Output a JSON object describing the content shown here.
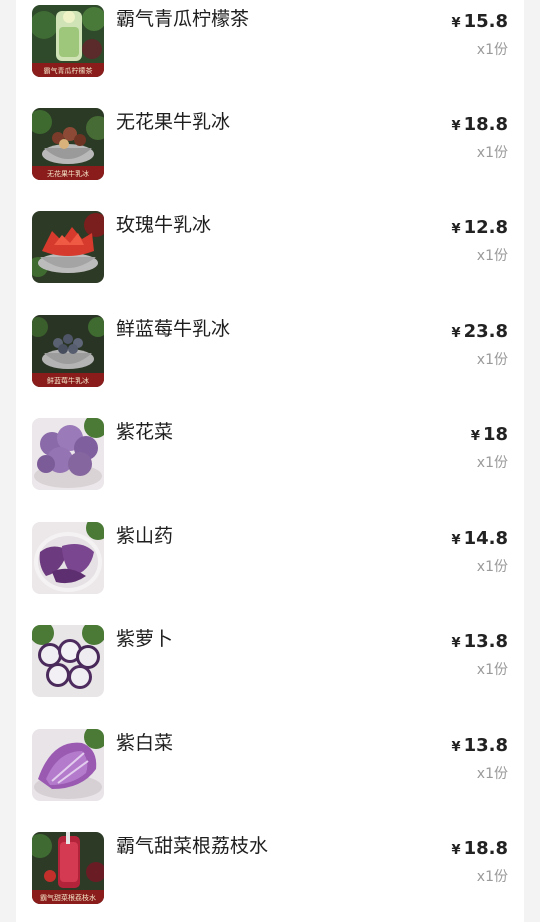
{
  "currency_symbol": "¥",
  "items": [
    {
      "name": "霸气青瓜柠檬茶",
      "price": "15.8",
      "qty": "x1份",
      "image_caption": "霸气青瓜柠檬茶",
      "image": "cucumber-lemon-tea"
    },
    {
      "name": "无花果牛乳冰",
      "price": "18.8",
      "qty": "x1份",
      "image_caption": "无花果牛乳冰",
      "image": "fig-milk-ice"
    },
    {
      "name": "玫瑰牛乳冰",
      "price": "12.8",
      "qty": "x1份",
      "image_caption": "",
      "image": "rose-milk-ice"
    },
    {
      "name": "鲜蓝莓牛乳冰",
      "price": "23.8",
      "qty": "x1份",
      "image_caption": "鲜蓝莓牛乳冰",
      "image": "blueberry-milk-ice"
    },
    {
      "name": "紫花菜",
      "price": "18",
      "qty": "x1份",
      "image_caption": "",
      "image": "purple-cauliflower"
    },
    {
      "name": "紫山药",
      "price": "14.8",
      "qty": "x1份",
      "image_caption": "",
      "image": "purple-yam"
    },
    {
      "name": "紫萝卜",
      "price": "13.8",
      "qty": "x1份",
      "image_caption": "",
      "image": "purple-radish"
    },
    {
      "name": "紫白菜",
      "price": "13.8",
      "qty": "x1份",
      "image_caption": "",
      "image": "purple-cabbage"
    },
    {
      "name": "霸气甜菜根荔枝水",
      "price": "18.8",
      "qty": "x1份",
      "image_caption": "霸气甜菜根荔枝水",
      "image": "beetroot-lychee-drink"
    }
  ]
}
